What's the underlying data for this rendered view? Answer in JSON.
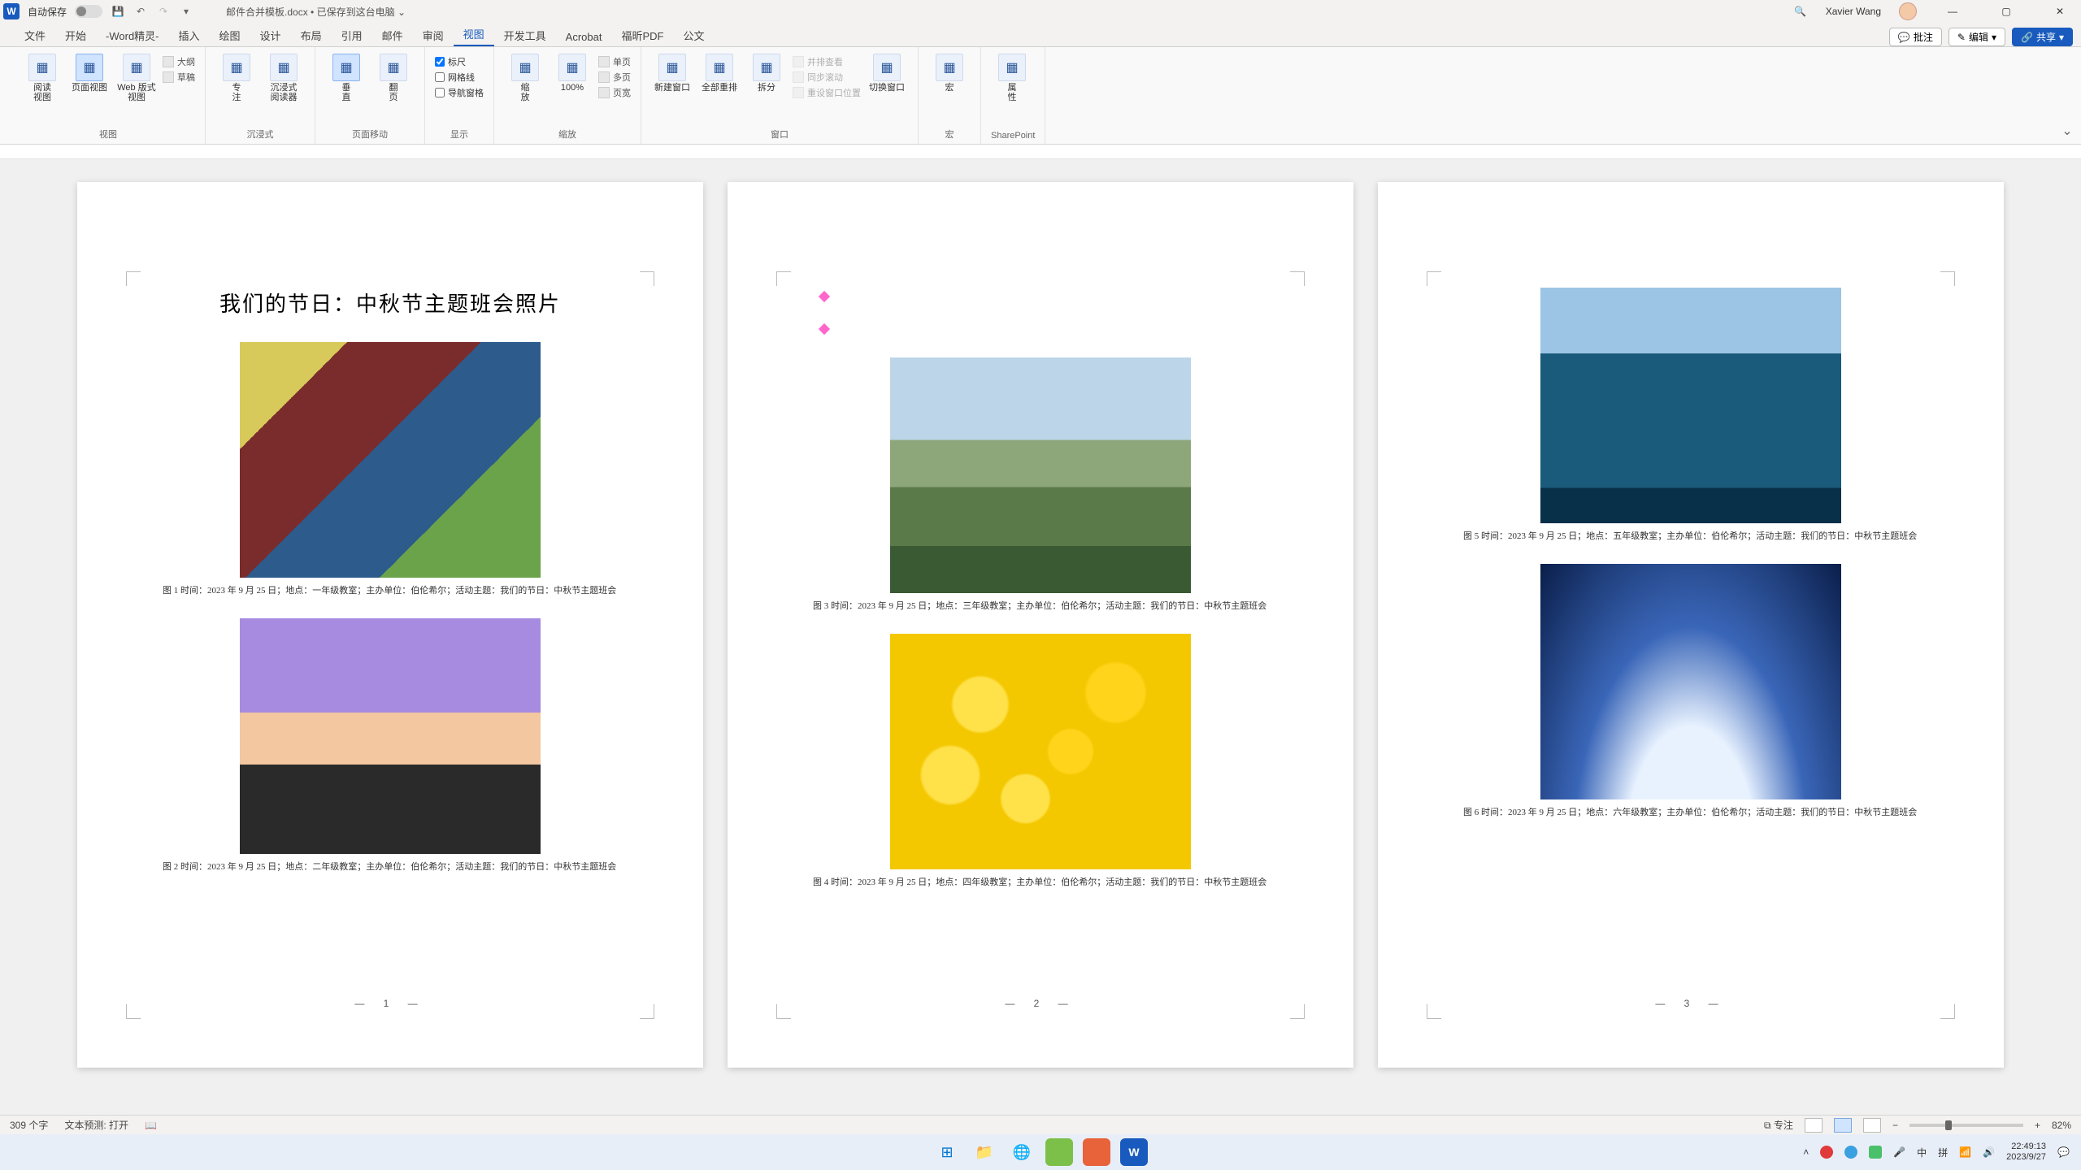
{
  "titlebar": {
    "autosave_label": "自动保存",
    "doc_name": "邮件合并模板.docx",
    "saved_state": "已保存到这台电脑",
    "user_name": "Xavier Wang"
  },
  "tabs": {
    "items": [
      "文件",
      "开始",
      "-Word精灵-",
      "插入",
      "绘图",
      "设计",
      "布局",
      "引用",
      "邮件",
      "审阅",
      "视图",
      "开发工具",
      "Acrobat",
      "福昕PDF",
      "公文"
    ],
    "active_index": 10,
    "comments_btn": "批注",
    "edit_btn": "编辑",
    "share_btn": "共享"
  },
  "ribbon": {
    "groups": [
      {
        "label": "视图",
        "big": [
          {
            "label": "阅读\n视图",
            "name": "read-view-button"
          },
          {
            "label": "页面视图",
            "name": "print-layout-button",
            "active": true
          },
          {
            "label": "Web 版式视图",
            "name": "web-layout-button"
          }
        ],
        "stack": [
          {
            "label": "大纲",
            "name": "outline-button"
          },
          {
            "label": "草稿",
            "name": "draft-button"
          }
        ]
      },
      {
        "label": "沉浸式",
        "big": [
          {
            "label": "专\n注",
            "name": "focus-button"
          },
          {
            "label": "沉浸式\n阅读器",
            "name": "immersive-reader-button"
          }
        ]
      },
      {
        "label": "页面移动",
        "big": [
          {
            "label": "垂\n直",
            "name": "vertical-button",
            "active": true
          },
          {
            "label": "翻\n页",
            "name": "side-to-side-button"
          }
        ]
      },
      {
        "label": "显示",
        "checks": [
          {
            "label": "标尺",
            "checked": true,
            "name": "ruler-check"
          },
          {
            "label": "网格线",
            "checked": false,
            "name": "gridlines-check"
          },
          {
            "label": "导航窗格",
            "checked": false,
            "name": "nav-pane-check"
          }
        ]
      },
      {
        "label": "缩放",
        "big": [
          {
            "label": "缩\n放",
            "name": "zoom-button"
          },
          {
            "label": "100%",
            "name": "zoom-100-button"
          }
        ],
        "stack": [
          {
            "label": "单页",
            "name": "one-page-button"
          },
          {
            "label": "多页",
            "name": "multi-page-button"
          },
          {
            "label": "页宽",
            "name": "page-width-button"
          }
        ]
      },
      {
        "label": "窗口",
        "big": [
          {
            "label": "新建窗口",
            "name": "new-window-button"
          },
          {
            "label": "全部重排",
            "name": "arrange-all-button"
          },
          {
            "label": "拆分",
            "name": "split-button"
          }
        ],
        "stack": [
          {
            "label": "并排查看",
            "name": "side-by-side-button",
            "disabled": true
          },
          {
            "label": "同步滚动",
            "name": "sync-scroll-button",
            "disabled": true
          },
          {
            "label": "重设窗口位置",
            "name": "reset-window-button",
            "disabled": true
          }
        ],
        "tail_big": [
          {
            "label": "切换窗口",
            "name": "switch-windows-button"
          }
        ]
      },
      {
        "label": "宏",
        "big": [
          {
            "label": "宏",
            "name": "macros-button"
          }
        ]
      },
      {
        "label": "SharePoint",
        "big": [
          {
            "label": "属\n性",
            "name": "properties-button"
          }
        ]
      }
    ]
  },
  "document": {
    "title": "我们的节日：中秋节主题班会照片",
    "pages": [
      {
        "num_display": "—  1  —",
        "markers": false,
        "figures": [
          {
            "img": "ph1",
            "caption": "图 1  时间：2023 年 9 月 25 日；地点：一年级教室；主办单位：伯伦希尔；活动主题：我们的节日：中秋节主题班会"
          },
          {
            "img": "ph2",
            "caption": "图 2  时间：2023 年 9 月 25 日；地点：二年级教室；主办单位：伯伦希尔；活动主题：我们的节日：中秋节主题班会"
          }
        ]
      },
      {
        "num_display": "—  2  —",
        "markers": true,
        "figures": [
          {
            "img": "ph3",
            "caption": "图 3  时间：2023 年 9 月 25 日；地点：三年级教室；主办单位：伯伦希尔；活动主题：我们的节日：中秋节主题班会"
          },
          {
            "img": "ph4",
            "caption": "图 4  时间：2023 年 9 月 25 日；地点：四年级教室；主办单位：伯伦希尔；活动主题：我们的节日：中秋节主题班会"
          }
        ]
      },
      {
        "num_display": "—  3  —",
        "markers": false,
        "figures": [
          {
            "img": "ph5",
            "caption": "图 5  时间：2023 年 9 月 25 日；地点：五年级教室；主办单位：伯伦希尔；活动主题：我们的节日：中秋节主题班会"
          },
          {
            "img": "ph6",
            "caption": "图 6  时间：2023 年 9 月 25 日；地点：六年级教室；主办单位：伯伦希尔；活动主题：我们的节日：中秋节主题班会"
          }
        ]
      }
    ]
  },
  "statusbar": {
    "word_count": "309 个字",
    "proof": "文本预测: 打开",
    "focus_label": "专注",
    "zoom_pct": "82%"
  },
  "taskbar": {
    "time": "22:49:13",
    "date": "2023/9/27"
  }
}
